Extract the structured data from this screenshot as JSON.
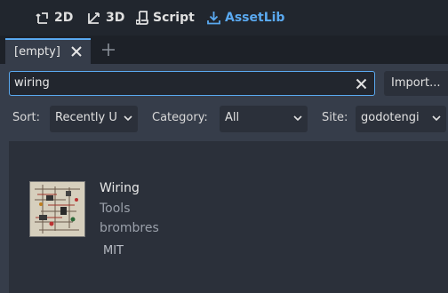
{
  "toolbar": {
    "modes": [
      {
        "label": "2D",
        "icon": "2d-node-icon"
      },
      {
        "label": "3D",
        "icon": "3d-node-icon"
      },
      {
        "label": "Script",
        "icon": "script-icon"
      },
      {
        "label": "AssetLib",
        "icon": "download-icon",
        "active": true
      }
    ],
    "accent": "#5aa9f0"
  },
  "tabs": [
    {
      "label": "[empty]"
    }
  ],
  "search": {
    "value": "wiring",
    "import_label": "Import..."
  },
  "filters": {
    "sort_label": "Sort:",
    "sort_value": "Recently U",
    "category_label": "Category:",
    "category_value": "All",
    "site_label": "Site:",
    "site_value": "godotengi"
  },
  "results": [
    {
      "title": "Wiring",
      "category": "Tools",
      "author": "brombres",
      "license": "MIT"
    }
  ]
}
